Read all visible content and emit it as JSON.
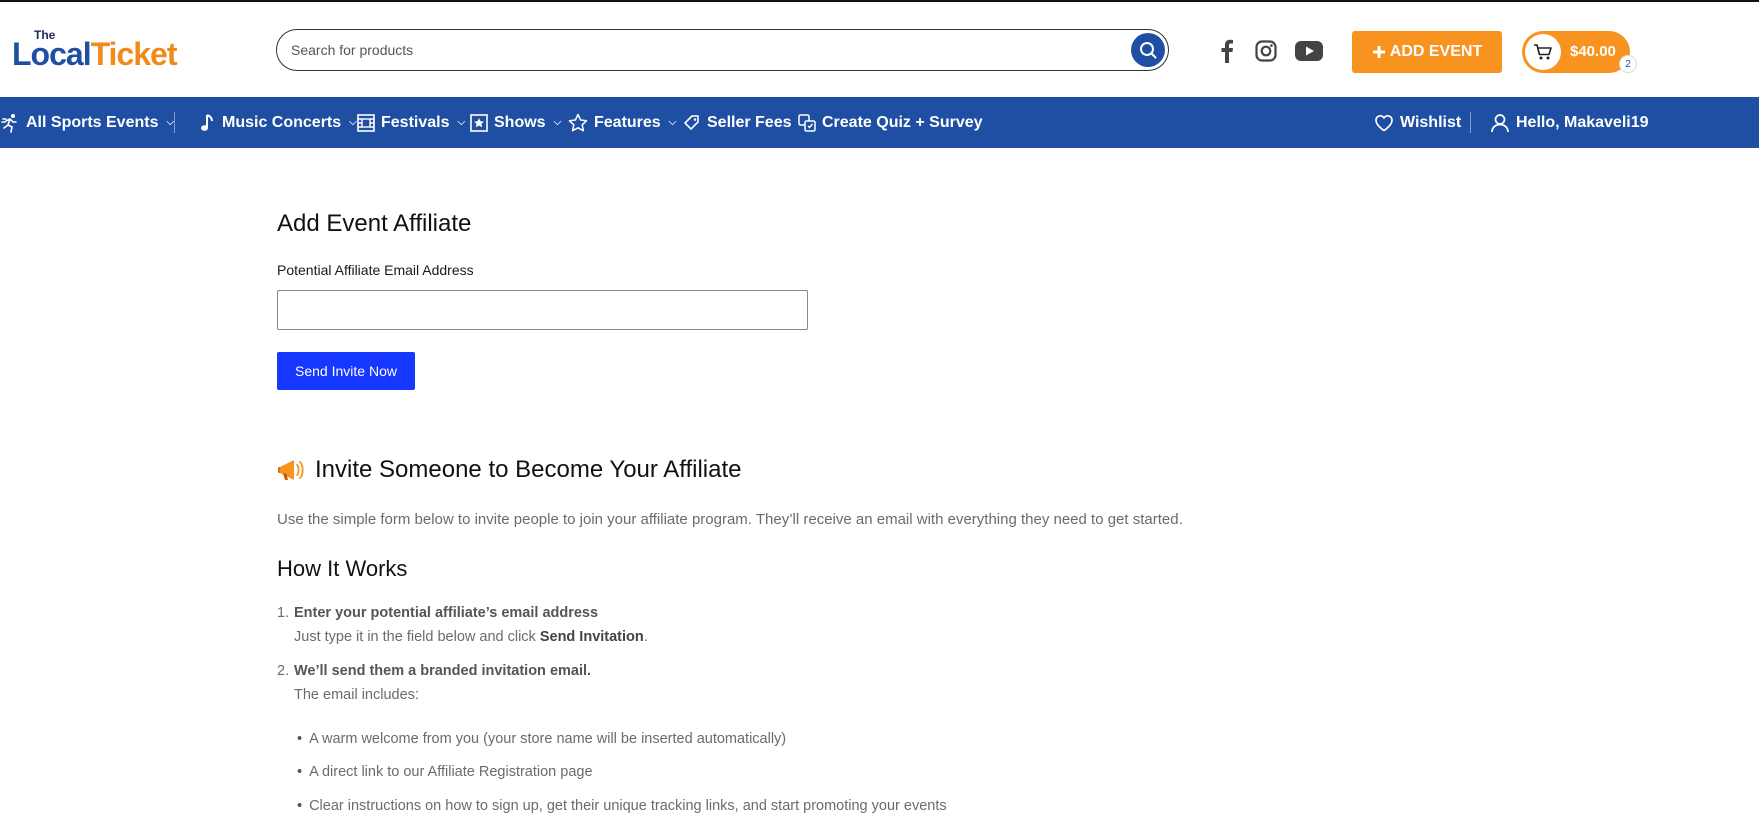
{
  "header": {
    "logo_the": "The",
    "logo_local": "Local",
    "logo_ticket": "Ticket",
    "search_placeholder": "Search for products",
    "add_event_label": "ADD EVENT",
    "cart_total": "$40.00",
    "cart_count": "2"
  },
  "nav": {
    "items": [
      {
        "label": "All Sports Events"
      },
      {
        "label": "Music Concerts"
      },
      {
        "label": "Festivals"
      },
      {
        "label": "Shows"
      },
      {
        "label": "Features"
      },
      {
        "label": "Seller Fees"
      },
      {
        "label": "Create Quiz + Survey"
      }
    ],
    "wishlist": "Wishlist",
    "account": "Hello, Makaveli19"
  },
  "form": {
    "title": "Add Event Affiliate",
    "email_label": "Potential Affiliate Email Address",
    "email_value": "",
    "submit_label": "Send Invite Now"
  },
  "info": {
    "title": "Invite Someone to Become Your Affiliate",
    "intro": "Use the simple form below to invite people to join your affiliate program. They’ll receive an email with everything they need to get started.",
    "how_title": "How It Works",
    "step1_title": "Enter your potential affiliate’s email address",
    "step1_text_pre": "Just type it in the field below and click ",
    "step1_text_bold": "Send Invitation",
    "step1_text_post": ".",
    "step2_title": "We’ll send them a branded invitation email.",
    "step2_text": "The email includes:",
    "bullets": [
      "A warm welcome from you (your store name will be inserted automatically)",
      "A direct link to our Affiliate Registration page",
      "Clear instructions on how to sign up, get their unique tracking links, and start promoting your events"
    ]
  },
  "colors": {
    "brand_blue": "#1f4fa3",
    "accent_orange": "#f7931e",
    "button_blue": "#1537ff"
  }
}
